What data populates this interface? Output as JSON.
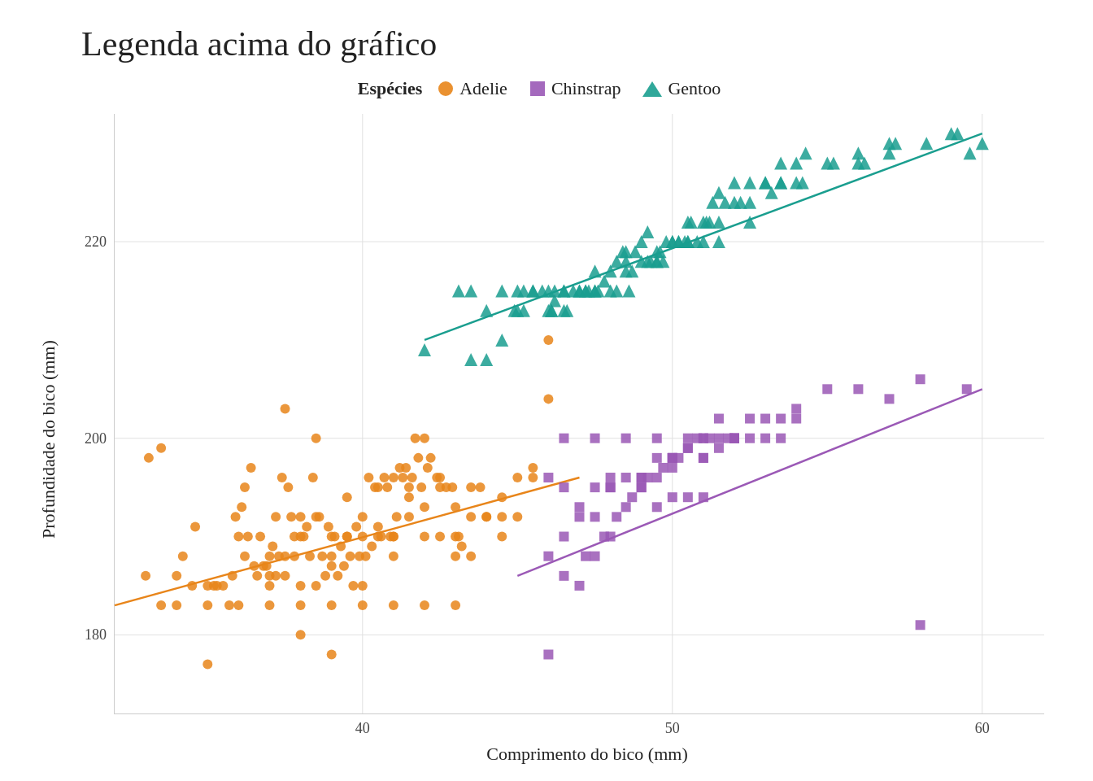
{
  "title": "Legenda acima do gráfico",
  "legend": {
    "title": "Espécies",
    "items": [
      {
        "label": "Adelie",
        "color": "#E8851A",
        "shape": "circle"
      },
      {
        "label": "Chinstrap",
        "color": "#9B59B6",
        "shape": "square"
      },
      {
        "label": "Gentoo",
        "color": "#1A9E8F",
        "shape": "triangle"
      }
    ]
  },
  "axes": {
    "x_label": "Comprimento do bico (mm)",
    "y_label": "Profundidade do bico (mm)",
    "x_ticks": [
      40,
      50,
      60
    ],
    "y_ticks": [
      180,
      200,
      220
    ],
    "x_min": 32,
    "x_max": 62,
    "y_min": 172,
    "y_max": 233
  },
  "colors": {
    "adelie": "#E8851A",
    "chinstrap": "#9B59B6",
    "gentoo": "#1A9E8F",
    "grid": "#e0e0e0",
    "axis": "#cccccc"
  }
}
